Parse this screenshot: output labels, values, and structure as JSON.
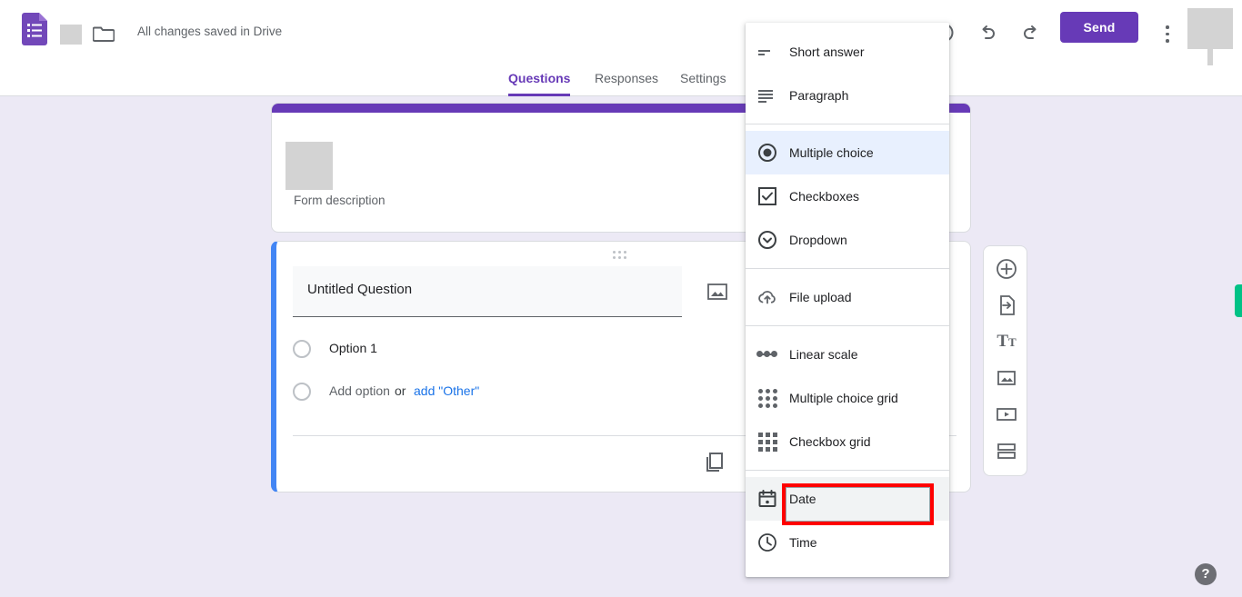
{
  "appbar": {
    "save_status": "All changes saved in Drive",
    "send_label": "Send",
    "logo_icon": "google-forms-logo",
    "folder_icon": "folder-icon",
    "theme_icon": "palette-icon",
    "preview_icon": "preview-eye-icon",
    "undo_icon": "undo-arrow-icon",
    "redo_icon": "redo-arrow-icon",
    "more_icon": "more-vertical-icon",
    "title_redaction": "",
    "avatar_redaction": ""
  },
  "tabs": [
    {
      "label": "Questions",
      "active": true
    },
    {
      "label": "Responses",
      "active": false
    },
    {
      "label": "Settings",
      "active": false
    }
  ],
  "form_header": {
    "title_redaction": "",
    "description": "Form description",
    "accent_color": "#673ab7"
  },
  "question_card": {
    "drag_handle_icon": "drag-handle-icon",
    "question_title": "Untitled Question",
    "image_icon": "add-image-icon",
    "duplicate_icon": "duplicate-icon",
    "accent_color": "#4285f4",
    "options": [
      {
        "label": "Option 1",
        "type": "radio"
      }
    ],
    "add_option_label": "Add option",
    "or_label": "or",
    "add_other_label": "add \"Other\"",
    "add_other_color": "#1a73e8"
  },
  "side_toolbar": [
    {
      "icon": "add-question-icon",
      "name": "add-question-button"
    },
    {
      "icon": "import-questions-icon",
      "name": "import-questions-button"
    },
    {
      "icon": "add-title-icon",
      "name": "add-title-button",
      "glyph": "T",
      "glyph_small": "T"
    },
    {
      "icon": "add-image-icon",
      "name": "add-image-button"
    },
    {
      "icon": "add-video-icon",
      "name": "add-video-button"
    },
    {
      "icon": "add-section-icon",
      "name": "add-section-button"
    }
  ],
  "type_menu": {
    "groups": [
      {
        "items": [
          {
            "label": "Short answer",
            "icon": "short-answer-icon",
            "state": "normal"
          },
          {
            "label": "Paragraph",
            "icon": "paragraph-icon",
            "state": "normal"
          }
        ]
      },
      {
        "items": [
          {
            "label": "Multiple choice",
            "icon": "radio-selected-icon",
            "state": "selected"
          },
          {
            "label": "Checkboxes",
            "icon": "checkbox-icon",
            "state": "normal"
          },
          {
            "label": "Dropdown",
            "icon": "dropdown-circle-icon",
            "state": "normal"
          }
        ]
      },
      {
        "items": [
          {
            "label": "File upload",
            "icon": "cloud-upload-icon",
            "state": "normal"
          }
        ]
      },
      {
        "items": [
          {
            "label": "Linear scale",
            "icon": "linear-scale-icon",
            "state": "normal"
          },
          {
            "label": "Multiple choice grid",
            "icon": "radio-grid-icon",
            "state": "normal"
          },
          {
            "label": "Checkbox grid",
            "icon": "checkbox-grid-icon",
            "state": "normal"
          }
        ]
      },
      {
        "items": [
          {
            "label": "Date",
            "icon": "calendar-icon",
            "state": "hovered"
          },
          {
            "label": "Time",
            "icon": "clock-icon",
            "state": "normal"
          }
        ]
      }
    ]
  },
  "annotation": {
    "target_label": "Date",
    "color": "#ff0000"
  },
  "help": {
    "label": "?"
  },
  "sheets_tab": {
    "color": "#00c286",
    "name": "sheets-edge-tab"
  }
}
